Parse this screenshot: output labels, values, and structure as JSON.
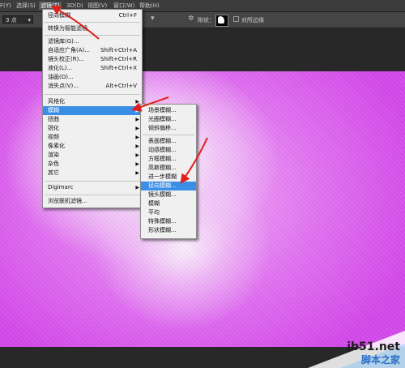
{
  "menubar": {
    "items": [
      "F(Y)",
      "选择(S)",
      "滤镜(T)",
      "3D(D)",
      "视图(V)",
      "窗口(W)",
      "帮助(H)"
    ]
  },
  "options": {
    "brush_size": "3 点",
    "sample_label": "附状：",
    "checkbox_label": "对所边缘"
  },
  "filter_menu": {
    "last_filter": "径向模糊",
    "last_filter_shortcut": "Ctrl+F",
    "convert_smart": "转换为智能滤镜",
    "gallery": "滤镜库(G)...",
    "adaptive_wide": "自适应广角(A)...",
    "adaptive_wide_shortcut": "Shift+Ctrl+A",
    "lens_correction": "镜头校正(R)...",
    "lens_correction_shortcut": "Shift+Ctrl+R",
    "liquify": "液化(L)...",
    "liquify_shortcut": "Shift+Ctrl+X",
    "oil_paint": "油画(O)...",
    "vanishing_point": "消失点(V)...",
    "vanishing_point_shortcut": "Alt+Ctrl+V",
    "wind": "风格化",
    "blur": "模糊",
    "distort": "扭曲",
    "sharpen": "锐化",
    "video": "视频",
    "pixelate": "像素化",
    "render": "渲染",
    "noise": "杂色",
    "other": "其它",
    "digimarc": "Digimarc",
    "browse_online": "浏览联机滤镜..."
  },
  "blur_submenu": {
    "field_blur": "场景模糊...",
    "iris_blur": "光圈模糊...",
    "tilt_shift": "倾斜偏移...",
    "surface_blur": "表面模糊...",
    "motion_blur": "动感模糊...",
    "box_blur": "方框模糊...",
    "gaussian_blur": "高斯模糊...",
    "blur_more": "进一步模糊",
    "radial_blur": "径向模糊...",
    "lens_blur": "镜头模糊...",
    "blur": "模糊",
    "average": "平均",
    "smart_blur": "特殊模糊...",
    "shape_blur": "形状模糊..."
  },
  "watermark": {
    "line1": "jb51.net",
    "line2": "脚本之家"
  },
  "colors": {
    "highlight": "#3a8ee6",
    "arrow": "#e0201a",
    "canvas_magenta": "#d448ea"
  }
}
